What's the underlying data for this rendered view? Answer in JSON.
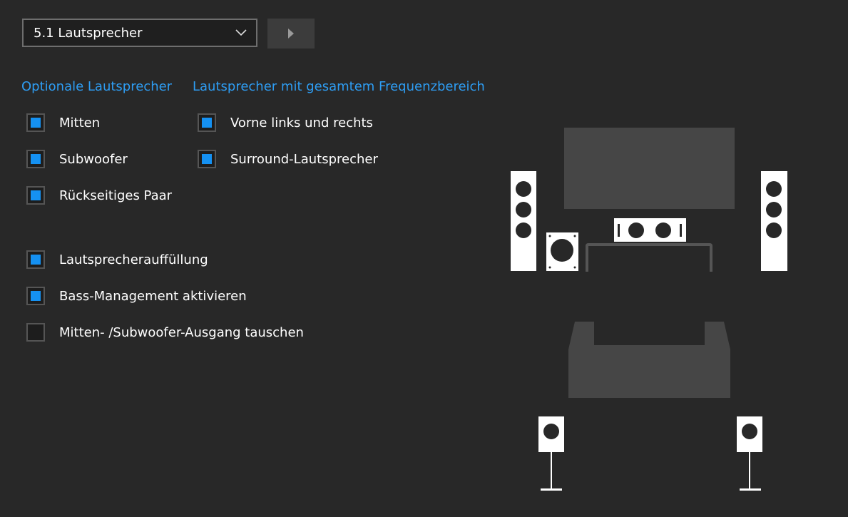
{
  "config_select": {
    "value": "5.1 Lautsprecher",
    "icon": "chevron-down-icon"
  },
  "test_button": {
    "icon": "play-icon"
  },
  "sections": {
    "optional_title": "Optionale Lautsprecher",
    "fullrange_title": "Lautsprecher mit gesamtem Frequenzbereich"
  },
  "optional_speakers": [
    {
      "label": "Mitten",
      "checked": true
    },
    {
      "label": "Subwoofer",
      "checked": true
    },
    {
      "label": "Rückseitiges Paar",
      "checked": true
    }
  ],
  "fullrange_speakers": [
    {
      "label": "Vorne links und rechts",
      "checked": true
    },
    {
      "label": "Surround-Lautsprecher",
      "checked": true
    }
  ],
  "options": [
    {
      "label": "Lautsprecherauffüllung",
      "checked": true
    },
    {
      "label": "Bass-Management aktivieren",
      "checked": true
    },
    {
      "label": "Mitten- /Subwoofer-Ausgang tauschen",
      "checked": false
    }
  ],
  "colors": {
    "background": "#282828",
    "accent": "#2e9df3",
    "checkbox_fill": "#1591f2",
    "speaker": "#ffffff",
    "furniture": "#464646"
  }
}
